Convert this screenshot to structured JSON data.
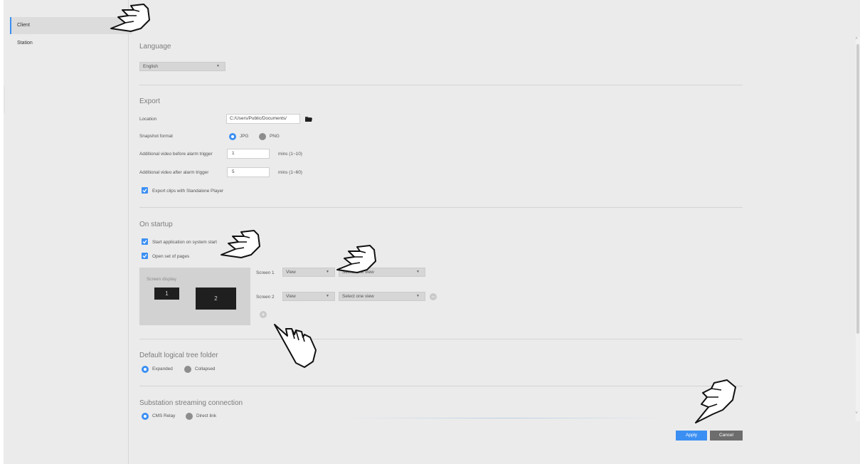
{
  "sidebar": {
    "items": [
      {
        "label": "Client",
        "active": true
      },
      {
        "label": "Station",
        "active": false
      }
    ]
  },
  "language": {
    "title": "Language",
    "selected": "English"
  },
  "export": {
    "title": "Export",
    "location_label": "Location",
    "location_value": "C:/Users/Public/Documents/",
    "snapshot_label": "Snapshot format",
    "snapshot_options": [
      "JPG",
      "PNG"
    ],
    "snapshot_selected": "JPG",
    "before_label": "Additional video before alarm trigger",
    "before_value": "1",
    "before_unit": "mins (1~10)",
    "after_label": "Additional video after alarm trigger",
    "after_value": "5",
    "after_unit": "mins (1~60)",
    "standalone_label": "Export clips with Standalone Player",
    "standalone_checked": true
  },
  "startup": {
    "title": "On startup",
    "start_app_label": "Start application on system start",
    "start_app_checked": true,
    "open_pages_label": "Open set of pages",
    "open_pages_checked": true,
    "screen_display_label": "Screen display",
    "screen1_num": "1",
    "screen2_num": "2",
    "screens": [
      {
        "label": "Screen 1",
        "view_type": "View",
        "view_select": "Select one view"
      },
      {
        "label": "Screen 2",
        "view_type": "View",
        "view_select": "Select one view"
      }
    ]
  },
  "tree": {
    "title": "Default logical tree folder",
    "options": [
      "Expanded",
      "Collapsed"
    ],
    "selected": "Expanded"
  },
  "substation": {
    "title": "Substation streaming connection",
    "options": [
      "CMS Relay",
      "Direct link"
    ],
    "selected": "CMS Relay"
  },
  "footer": {
    "apply_label": "Apply",
    "cancel_label": "Cancel"
  },
  "colors": {
    "accent": "#3b8ff3",
    "background": "#ebebeb",
    "cancel": "#6d6d6d"
  },
  "icons": [
    "folder-icon",
    "caret-down-icon",
    "check-icon",
    "add-icon",
    "remove-icon",
    "pointing-hand-icon"
  ]
}
